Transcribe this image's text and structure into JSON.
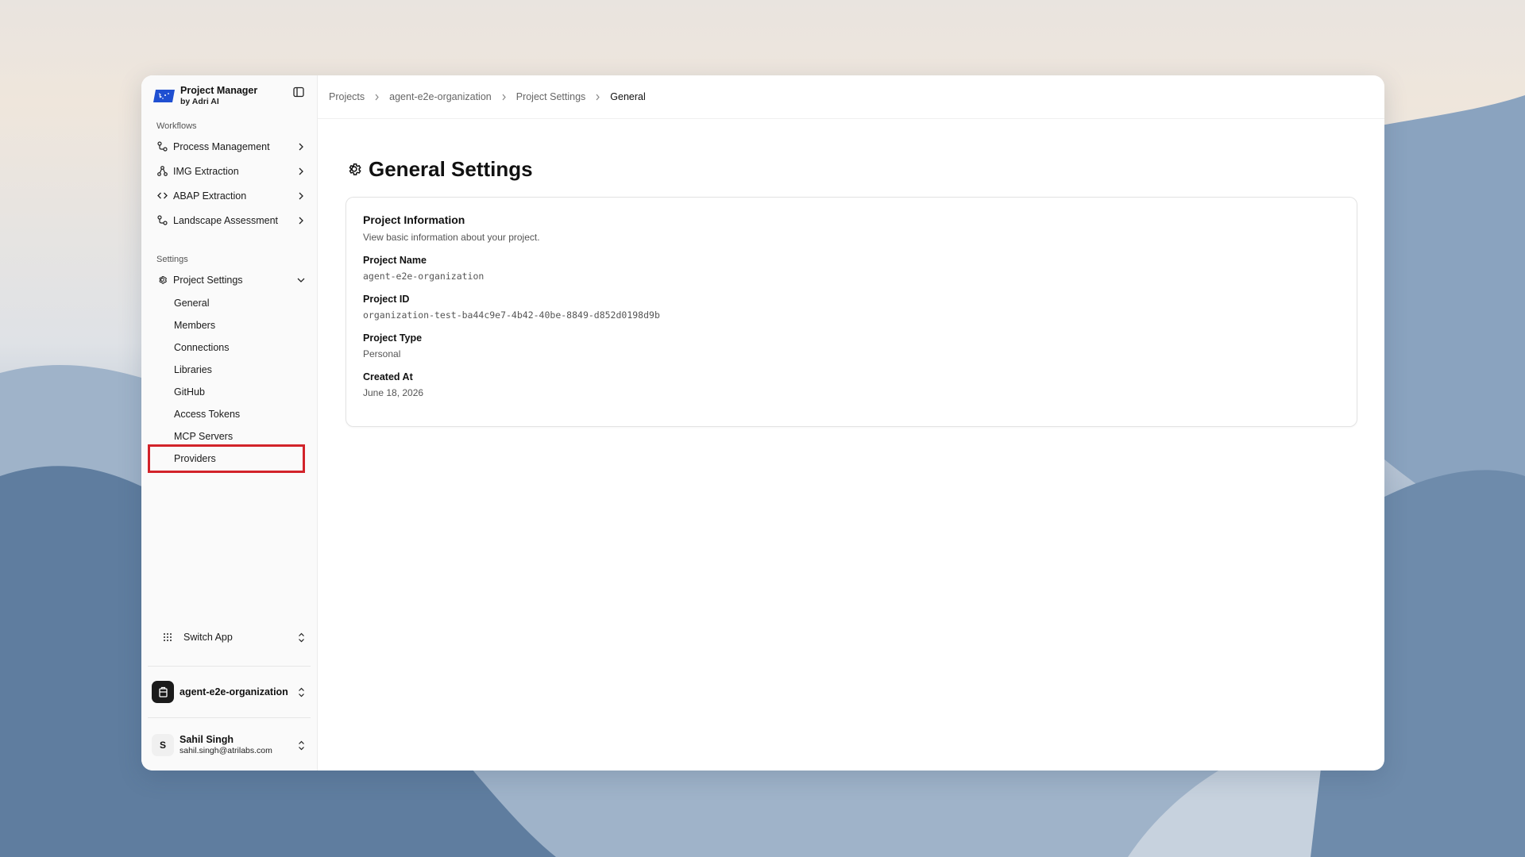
{
  "brand": {
    "title": "Project Manager",
    "subtitle": "by Adri AI"
  },
  "sidebar": {
    "workflows_label": "Workflows",
    "workflows": [
      {
        "label": "Process Management",
        "icon": "workflow-icon"
      },
      {
        "label": "IMG Extraction",
        "icon": "network-icon"
      },
      {
        "label": "ABAP Extraction",
        "icon": "code-icon"
      },
      {
        "label": "Landscape Assessment",
        "icon": "workflow-icon"
      }
    ],
    "settings_label": "Settings",
    "project_settings": {
      "label": "Project Settings",
      "icon": "gear-icon"
    },
    "sub_items": [
      "General",
      "Members",
      "Connections",
      "Libraries",
      "GitHub",
      "Access Tokens",
      "MCP Servers",
      "Providers"
    ],
    "switch_app": "Switch App",
    "organization": "agent-e2e-organization",
    "user": {
      "name": "Sahil Singh",
      "email": "sahil.singh@atrilabs.com",
      "initial": "S"
    }
  },
  "breadcrumb": [
    "Projects",
    "agent-e2e-organization",
    "Project Settings",
    "General"
  ],
  "page": {
    "title": "General Settings"
  },
  "card": {
    "title": "Project Information",
    "description": "View basic information about your project.",
    "fields": [
      {
        "label": "Project Name",
        "value": "agent-e2e-organization"
      },
      {
        "label": "Project ID",
        "value": "organization-test-ba44c9e7-4b42-40be-8849-d852d0198d9b"
      },
      {
        "label": "Project Type",
        "value": "Personal"
      },
      {
        "label": "Created At",
        "value": "June 18, 2026"
      }
    ]
  },
  "colors": {
    "highlight": "#d2232a",
    "logo": "#1f4fd1",
    "text": "#111111"
  }
}
